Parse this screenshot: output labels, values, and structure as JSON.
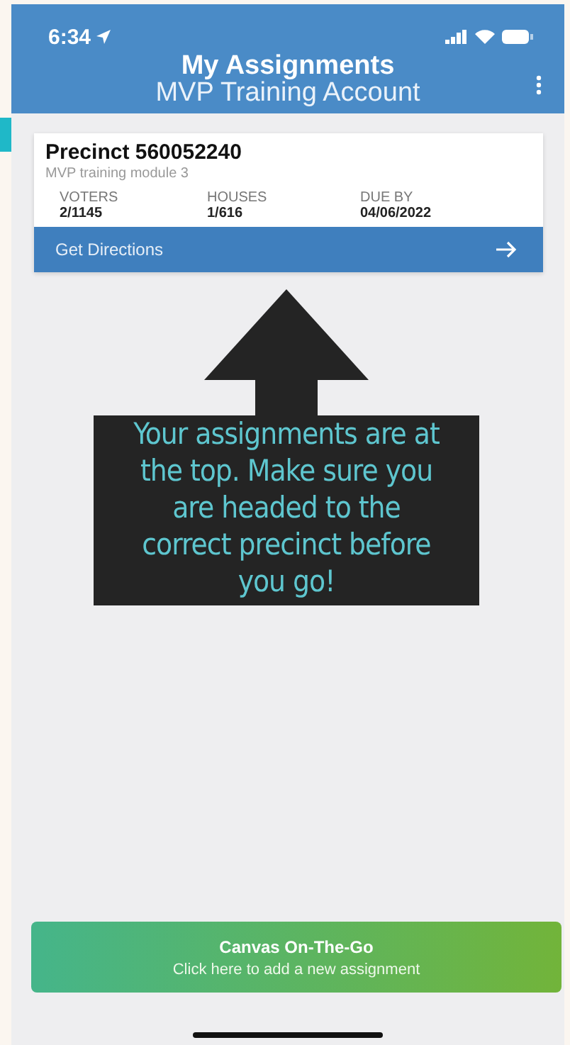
{
  "status_bar": {
    "time": "6:34"
  },
  "header": {
    "title": "My Assignments",
    "subtitle": "MVP Training Account"
  },
  "assignments": [
    {
      "title": "Precinct 560052240",
      "subtitle": "MVP training module 3",
      "stats": [
        {
          "label": "VOTERS",
          "value": "2/1145"
        },
        {
          "label": "HOUSES",
          "value": "1/616"
        },
        {
          "label": "DUE BY",
          "value": "04/06/2022"
        }
      ],
      "action": "Get Directions"
    }
  ],
  "tip": {
    "text": "Your assignments are at the top. Make sure you are headed to the correct precinct before you go!"
  },
  "canvas_button": {
    "title": "Canvas On-The-Go",
    "subtitle": "Click here to add a new assignment"
  }
}
